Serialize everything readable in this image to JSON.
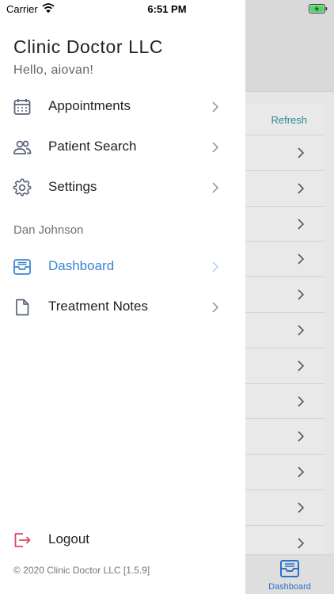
{
  "status_bar": {
    "carrier": "Carrier",
    "time": "6:51 PM"
  },
  "drawer": {
    "title": "Clinic Doctor LLC",
    "greeting": "Hello, aiovan!",
    "items": [
      {
        "label": "Appointments",
        "icon": "calendar-icon"
      },
      {
        "label": "Patient Search",
        "icon": "people-icon"
      },
      {
        "label": "Settings",
        "icon": "gear-icon"
      }
    ],
    "section_label": "Dan Johnson",
    "section_items": [
      {
        "label": "Dashboard",
        "icon": "inbox-tray-icon",
        "active": true
      },
      {
        "label": "Treatment Notes",
        "icon": "document-icon"
      }
    ],
    "logout_label": "Logout",
    "footer": "© 2020 Clinic Doctor LLC [1.5.9]"
  },
  "background": {
    "refresh_label": "Refresh",
    "tab_label": "Dashboard"
  },
  "colors": {
    "accent": "#3a86cf",
    "logout": "#e0455f",
    "teal": "#2a8a93"
  }
}
